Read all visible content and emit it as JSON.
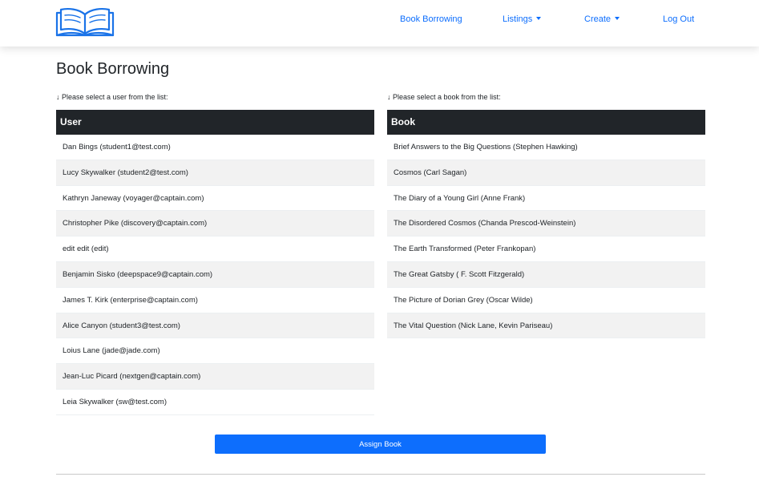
{
  "nav": {
    "logo_icon": "open-book-icon",
    "links": [
      {
        "label": "Book Borrowing"
      },
      {
        "label": "Listings"
      },
      {
        "label": "Create"
      },
      {
        "label": "Log Out"
      }
    ]
  },
  "page": {
    "title": "Book Borrowing"
  },
  "users": {
    "hint": "↓ Please select a user from the list:",
    "header": "User",
    "rows": [
      "Dan Bings (student1@test.com)",
      "Lucy Skywalker (student2@test.com)",
      "Kathryn Janeway (voyager@captain.com)",
      "Christopher Pike (discovery@captain.com)",
      "edit edit (edit)",
      "Benjamin Sisko (deepspace9@captain.com)",
      "James T. Kirk (enterprise@captain.com)",
      "Alice Canyon (student3@test.com)",
      "Loius Lane (jade@jade.com)",
      "Jean-Luc Picard (nextgen@captain.com)",
      "Leia Skywalker (sw@test.com)"
    ]
  },
  "books": {
    "hint": "↓ Please select a book from the list:",
    "header": "Book",
    "rows": [
      "Brief Answers to the Big Questions (Stephen Hawking)",
      "Cosmos (Carl Sagan)",
      "The Diary of a Young Girl (Anne Frank)",
      "The Disordered Cosmos (Chanda Prescod-Weinstein)",
      "The Earth Transformed (Peter Frankopan)",
      "The Great Gatsby ( F. Scott Fitzgerald)",
      "The Picture of Dorian Grey (Oscar Wilde)",
      "The Vital Question (Nick Lane, Kevin Pariseau)"
    ]
  },
  "actions": {
    "assign_label": "Assign Book"
  },
  "colors": {
    "accent": "#0d6efd",
    "table_header": "#212529",
    "row_stripe": "#f2f2f2"
  }
}
